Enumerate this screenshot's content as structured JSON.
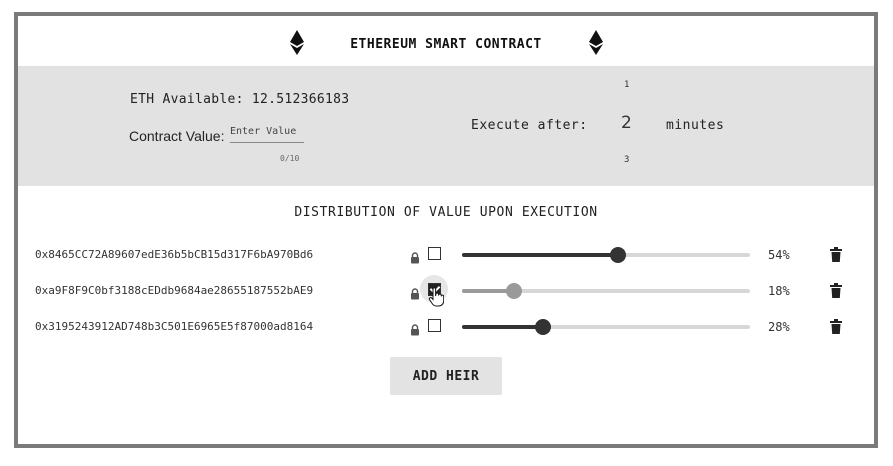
{
  "header": {
    "title": "ETHEREUM SMART CONTRACT",
    "left_icon": "ethereum-icon",
    "right_icon": "ethereum-icon"
  },
  "contract": {
    "eth_available": "ETH Available: 12.512366183",
    "value_label": "Contract Value:",
    "value_placeholder": "Enter Value",
    "value_counter": "0/10"
  },
  "execute": {
    "label": "Execute after:",
    "prev": "1",
    "value": "2",
    "next": "3",
    "unit": "minutes"
  },
  "distribution": {
    "title": "DISTRIBUTION OF VALUE UPON EXECUTION",
    "heirs": [
      {
        "address": "0x8465CC72A89607edE36b5bCB15d317F6bA970Bd6",
        "locked": false,
        "percent_label": "54%",
        "percent": 54
      },
      {
        "address": "0xa9F8F9C0bf3188cEDdb9684ae28655187552bAE9",
        "locked": true,
        "percent_label": "18%",
        "percent": 18
      },
      {
        "address": "0x3195243912AD748b3C501E6965E5f87000ad8164",
        "locked": false,
        "percent_label": "28%",
        "percent": 28
      }
    ]
  },
  "actions": {
    "add_heir": "ADD HEIR"
  },
  "colors": {
    "frame": "#7a7a7a",
    "panel": "#e2e2e2",
    "slider_active": "#333333",
    "slider_disabled": "#9a9a9a"
  }
}
